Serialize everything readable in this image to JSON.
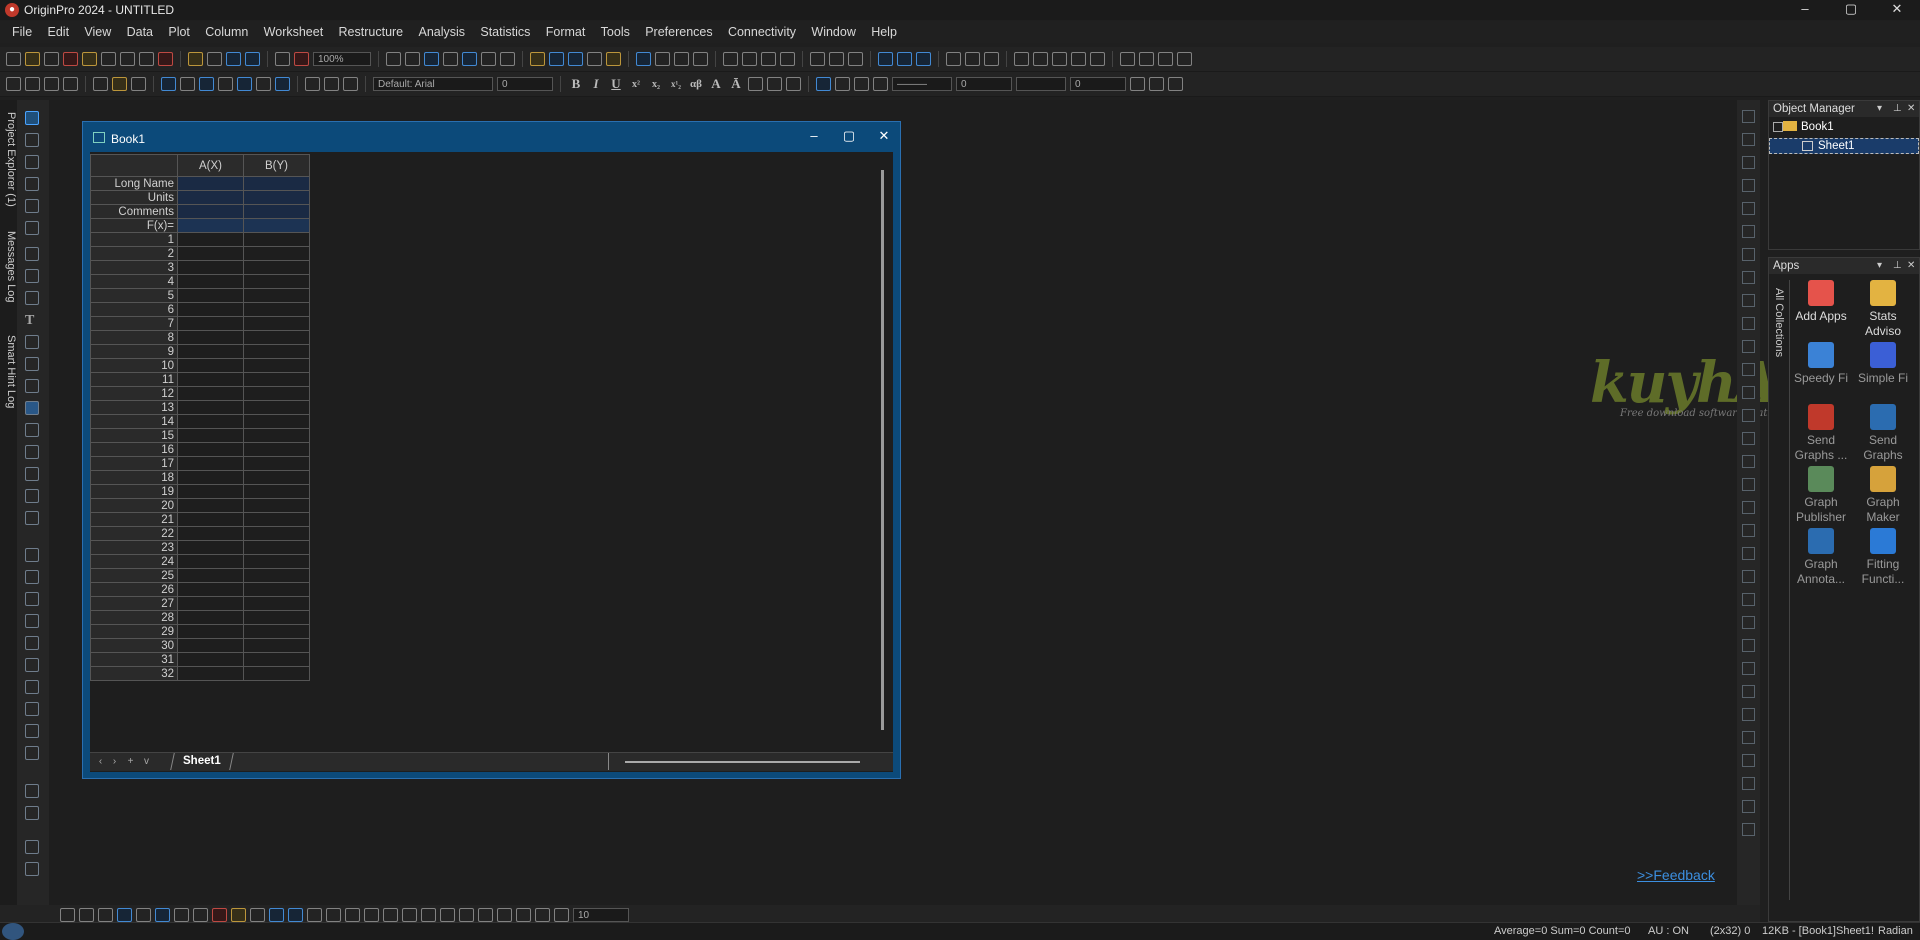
{
  "app": {
    "title": "OriginPro 2024 - UNTITLED",
    "logo_glyph": "●",
    "window_controls": [
      "–",
      "▢",
      "✕"
    ]
  },
  "menu": [
    "File",
    "Edit",
    "View",
    "Data",
    "Plot",
    "Column",
    "Worksheet",
    "Restructure",
    "Analysis",
    "Statistics",
    "Format",
    "Tools",
    "Preferences",
    "Connectivity",
    "Window",
    "Help"
  ],
  "toolbar": {
    "zoom": "100%",
    "font": "Default: Arial",
    "font_size": "0",
    "format_buttons": [
      "B",
      "I",
      "U",
      "x²",
      "x₂",
      "x¹₂",
      "αβ",
      "A",
      "Ā"
    ],
    "line_width": "0",
    "border_width": "0"
  },
  "left_dock": {
    "tabs": [
      "Project Explorer (1)",
      "Messages Log",
      "Smart Hint Log"
    ]
  },
  "book": {
    "title": "Book1",
    "controls": [
      "–",
      "▢",
      "✕"
    ],
    "columns": [
      "A(X)",
      "B(Y)"
    ],
    "header_rows": [
      "Long Name",
      "Units",
      "Comments",
      "F(x)="
    ],
    "row_numbers": [
      "1",
      "2",
      "3",
      "4",
      "5",
      "6",
      "7",
      "8",
      "9",
      "10",
      "11",
      "12",
      "13",
      "14",
      "15",
      "16",
      "17",
      "18",
      "19",
      "20",
      "21",
      "22",
      "23",
      "24",
      "25",
      "26",
      "27",
      "28",
      "29",
      "30",
      "31",
      "32"
    ],
    "sheet_tab": "Sheet1",
    "nav_buttons": [
      "‹",
      "›",
      "+",
      "v"
    ]
  },
  "object_manager": {
    "title": "Object Manager",
    "book": "Book1",
    "sheet": "Sheet1"
  },
  "apps": {
    "title": "Apps",
    "tabs_label": "All  Collections",
    "items": [
      {
        "label": "Add Apps",
        "color": "#e5534b"
      },
      {
        "label": "Stats Adviso",
        "color": "#e3b341"
      },
      {
        "label": "Speedy Fi",
        "color": "#3b82d6"
      },
      {
        "label": "Simple Fi",
        "color": "#3b5fd6"
      },
      {
        "label": "Send Graphs ...",
        "color": "#c0392b"
      },
      {
        "label": "Send Graphs",
        "color": "#2b6cb0"
      },
      {
        "label": "Graph Publisher",
        "color": "#5a8a5a"
      },
      {
        "label": "Graph Maker",
        "color": "#d6a23b"
      },
      {
        "label": "Graph Annota...",
        "color": "#2b6cb0"
      },
      {
        "label": "Fitting Functi...",
        "color": "#2b7ad6"
      }
    ]
  },
  "feedback": ">>Feedback",
  "watermark": {
    "main": "kuyhAa.Me",
    "sub": "Free download software gratis"
  },
  "bottom_toolbar": {
    "font_size": "10"
  },
  "status": {
    "stats": "Average=0 Sum=0 Count=0",
    "au": "AU : ON",
    "dims": "(2x32) 0",
    "size": "12KB - [Book1]Sheet1!",
    "angle": "Radian"
  }
}
